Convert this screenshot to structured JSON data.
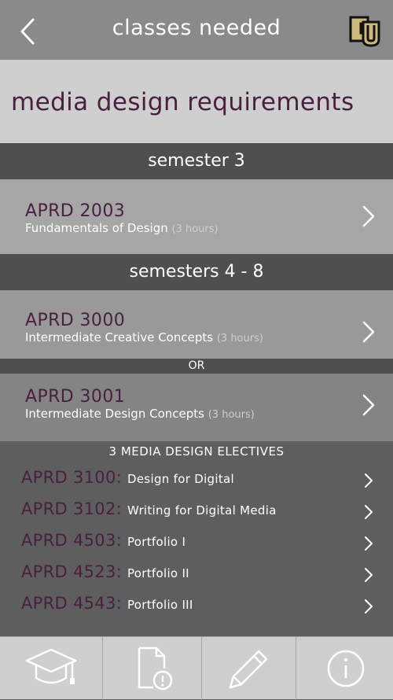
{
  "header": {
    "title": "classes needed"
  },
  "banner": {
    "heading": "media design requirements"
  },
  "sections": {
    "s3": "semester 3",
    "s48": "semesters 4 - 8",
    "or": "OR",
    "electives_title": "3 MEDIA DESIGN ELECTIVES"
  },
  "courses": [
    {
      "code": "APRD 2003",
      "name": "Fundamentals of Design",
      "hours": "(3 hours)"
    },
    {
      "code": "APRD 3000",
      "name": "Intermediate Creative Concepts",
      "hours": "(3 hours)"
    },
    {
      "code": "APRD 3001",
      "name": "Intermediate Design Concepts",
      "hours": "(3 hours)"
    }
  ],
  "electives": [
    {
      "code": "APRD 3100:",
      "name": "Design for Digital"
    },
    {
      "code": "APRD 3102:",
      "name": "Writing for Digital Media"
    },
    {
      "code": "APRD 4503:",
      "name": "Portfolio I"
    },
    {
      "code": "APRD 4523:",
      "name": "Portfolio II"
    },
    {
      "code": "APRD 4543:",
      "name": "Portfolio III"
    }
  ],
  "tabs": {
    "t1": "graduation-cap-icon",
    "t2": "document-alert-icon",
    "t3": "pencil-icon",
    "t4": "info-icon"
  },
  "colors": {
    "accent": "#4a1f3f",
    "logo_gold": "#cfb87c"
  }
}
